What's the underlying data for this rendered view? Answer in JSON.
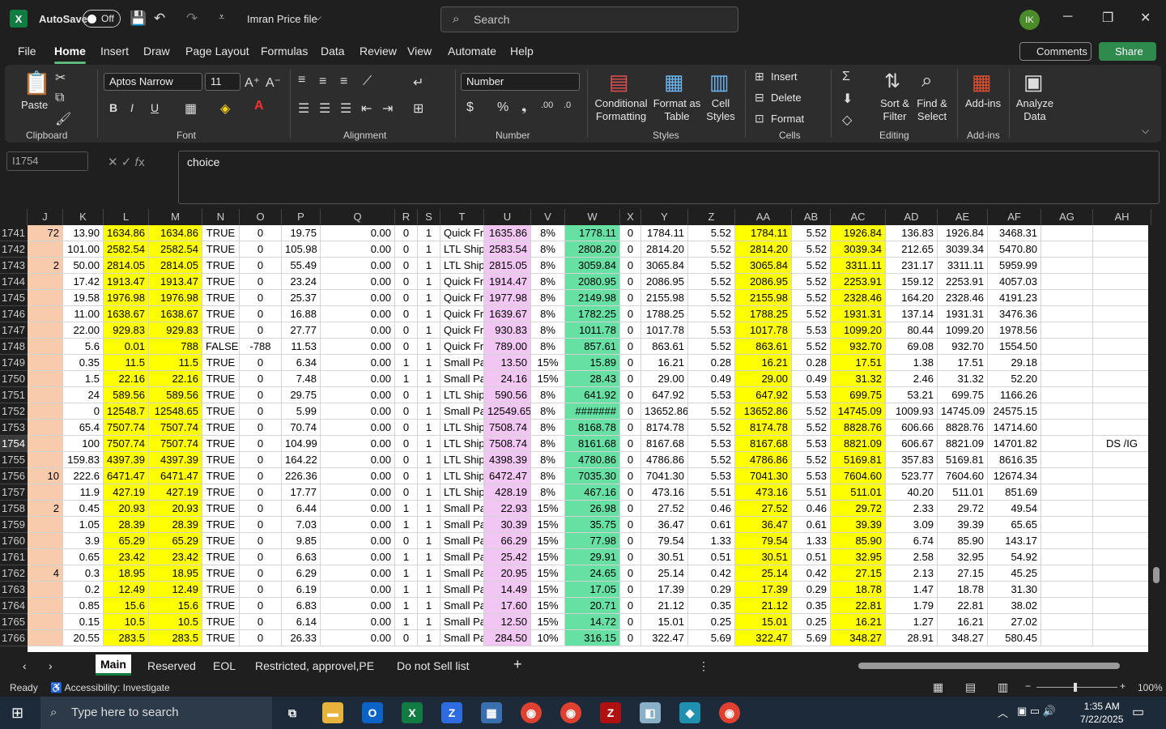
{
  "titlebar": {
    "autosave_label": "AutoSave",
    "autosave_state": "Off",
    "filename": "Imran Price file",
    "search_placeholder": "Search",
    "user_initials": "IK"
  },
  "menu": {
    "items": [
      "File",
      "Home",
      "Insert",
      "Draw",
      "Page Layout",
      "Formulas",
      "Data",
      "Review",
      "View",
      "Automate",
      "Help"
    ],
    "comments": "Comments",
    "share": "Share"
  },
  "ribbon": {
    "paste": "Paste",
    "clipboard": "Clipboard",
    "font_name": "Aptos Narrow",
    "font_size": "11",
    "font": "Font",
    "alignment": "Alignment",
    "number_format": "Number",
    "number": "Number",
    "conditional_formatting": "Conditional Formatting",
    "format_as_table": "Format as Table",
    "cell_styles": "Cell Styles",
    "styles": "Styles",
    "insert": "Insert",
    "delete": "Delete",
    "format": "Format",
    "cells": "Cells",
    "sort_filter": "Sort & Filter",
    "find_select": "Find & Select",
    "editing": "Editing",
    "addins_btn": "Add-ins",
    "addins": "Add-ins",
    "analyze_data": "Analyze Data"
  },
  "formula": {
    "namebox": "I1754",
    "value": "choice"
  },
  "columns": [
    "J",
    "K",
    "L",
    "M",
    "N",
    "O",
    "P",
    "Q",
    "R",
    "S",
    "T",
    "U",
    "V",
    "W",
    "X",
    "Y",
    "Z",
    "AA",
    "AB",
    "AC",
    "AD",
    "AE",
    "AF",
    "AG",
    "AH"
  ],
  "rows": [
    {
      "n": "1741",
      "c": [
        "72",
        "13.90",
        "1634.86",
        "1634.86",
        "TRUE",
        "0",
        "19.75",
        "0.00",
        "0",
        "1",
        "Quick Fr",
        "1635.86",
        "8%",
        "1778.11",
        "0",
        "1784.11",
        "5.52",
        "1784.11",
        "5.52",
        "1926.84",
        "136.83",
        "1926.84",
        "3468.31",
        "",
        ""
      ]
    },
    {
      "n": "1742",
      "c": [
        "",
        "101.00",
        "2582.54",
        "2582.54",
        "TRUE",
        "0",
        "105.98",
        "0.00",
        "0",
        "1",
        "LTL Ship",
        "2583.54",
        "8%",
        "2808.20",
        "0",
        "2814.20",
        "5.52",
        "2814.20",
        "5.52",
        "3039.34",
        "212.65",
        "3039.34",
        "5470.80",
        "",
        ""
      ]
    },
    {
      "n": "1743",
      "c": [
        "2",
        "50.00",
        "2814.05",
        "2814.05",
        "TRUE",
        "0",
        "55.49",
        "0.00",
        "0",
        "1",
        "LTL Ship",
        "2815.05",
        "8%",
        "3059.84",
        "0",
        "3065.84",
        "5.52",
        "3065.84",
        "5.52",
        "3311.11",
        "231.17",
        "3311.11",
        "5959.99",
        "",
        ""
      ]
    },
    {
      "n": "1744",
      "c": [
        "",
        "17.42",
        "1913.47",
        "1913.47",
        "TRUE",
        "0",
        "23.24",
        "0.00",
        "0",
        "1",
        "Quick Fr",
        "1914.47",
        "8%",
        "2080.95",
        "0",
        "2086.95",
        "5.52",
        "2086.95",
        "5.52",
        "2253.91",
        "159.12",
        "2253.91",
        "4057.03",
        "",
        ""
      ]
    },
    {
      "n": "1745",
      "c": [
        "",
        "19.58",
        "1976.98",
        "1976.98",
        "TRUE",
        "0",
        "25.37",
        "0.00",
        "0",
        "1",
        "Quick Fr",
        "1977.98",
        "8%",
        "2149.98",
        "0",
        "2155.98",
        "5.52",
        "2155.98",
        "5.52",
        "2328.46",
        "164.20",
        "2328.46",
        "4191.23",
        "",
        ""
      ]
    },
    {
      "n": "1746",
      "c": [
        "",
        "11.00",
        "1638.67",
        "1638.67",
        "TRUE",
        "0",
        "16.88",
        "0.00",
        "0",
        "1",
        "Quick Fr",
        "1639.67",
        "8%",
        "1782.25",
        "0",
        "1788.25",
        "5.52",
        "1788.25",
        "5.52",
        "1931.31",
        "137.14",
        "1931.31",
        "3476.36",
        "",
        ""
      ]
    },
    {
      "n": "1747",
      "c": [
        "",
        "22.00",
        "929.83",
        "929.83",
        "TRUE",
        "0",
        "27.77",
        "0.00",
        "0",
        "1",
        "Quick Fr",
        "930.83",
        "8%",
        "1011.78",
        "0",
        "1017.78",
        "5.53",
        "1017.78",
        "5.53",
        "1099.20",
        "80.44",
        "1099.20",
        "1978.56",
        "",
        ""
      ]
    },
    {
      "n": "1748",
      "c": [
        "",
        "5.6",
        "0.01",
        "788",
        "FALSE",
        "-788",
        "11.53",
        "0.00",
        "0",
        "1",
        "Quick Fr",
        "789.00",
        "8%",
        "857.61",
        "0",
        "863.61",
        "5.52",
        "863.61",
        "5.52",
        "932.70",
        "69.08",
        "932.70",
        "1554.50",
        "",
        ""
      ]
    },
    {
      "n": "1749",
      "c": [
        "",
        "0.35",
        "11.5",
        "11.5",
        "TRUE",
        "0",
        "6.34",
        "0.00",
        "1",
        "1",
        "Small Pa",
        "13.50",
        "15%",
        "15.89",
        "0",
        "16.21",
        "0.28",
        "16.21",
        "0.28",
        "17.51",
        "1.38",
        "17.51",
        "29.18",
        "",
        ""
      ]
    },
    {
      "n": "1750",
      "c": [
        "",
        "1.5",
        "22.16",
        "22.16",
        "TRUE",
        "0",
        "7.48",
        "0.00",
        "1",
        "1",
        "Small Pa",
        "24.16",
        "15%",
        "28.43",
        "0",
        "29.00",
        "0.49",
        "29.00",
        "0.49",
        "31.32",
        "2.46",
        "31.32",
        "52.20",
        "",
        ""
      ]
    },
    {
      "n": "1751",
      "c": [
        "",
        "24",
        "589.56",
        "589.56",
        "TRUE",
        "0",
        "29.75",
        "0.00",
        "0",
        "1",
        "LTL Ship",
        "590.56",
        "8%",
        "641.92",
        "0",
        "647.92",
        "5.53",
        "647.92",
        "5.53",
        "699.75",
        "53.21",
        "699.75",
        "1166.26",
        "",
        ""
      ]
    },
    {
      "n": "1752",
      "c": [
        "",
        "0",
        "12548.7",
        "12548.65",
        "TRUE",
        "0",
        "5.99",
        "0.00",
        "0",
        "1",
        "Small Pa",
        "12549.65",
        "8%",
        "#######",
        "0",
        "13652.86",
        "5.52",
        "13652.86",
        "5.52",
        "14745.09",
        "1009.93",
        "14745.09",
        "24575.15",
        "",
        ""
      ]
    },
    {
      "n": "1753",
      "c": [
        "",
        "65.4",
        "7507.74",
        "7507.74",
        "TRUE",
        "0",
        "70.74",
        "0.00",
        "0",
        "1",
        "LTL Ship",
        "7508.74",
        "8%",
        "8168.78",
        "0",
        "8174.78",
        "5.52",
        "8174.78",
        "5.52",
        "8828.76",
        "606.66",
        "8828.76",
        "14714.60",
        "",
        ""
      ]
    },
    {
      "n": "1754",
      "c": [
        "",
        "100",
        "7507.74",
        "7507.74",
        "TRUE",
        "0",
        "104.99",
        "0.00",
        "0",
        "1",
        "LTL Ship",
        "7508.74",
        "8%",
        "8161.68",
        "0",
        "8167.68",
        "5.53",
        "8167.68",
        "5.53",
        "8821.09",
        "606.67",
        "8821.09",
        "14701.82",
        "",
        "DS /IG"
      ]
    },
    {
      "n": "1755",
      "c": [
        "",
        "159.83",
        "4397.39",
        "4397.39",
        "TRUE",
        "0",
        "164.22",
        "0.00",
        "0",
        "1",
        "LTL Ship",
        "4398.39",
        "8%",
        "4780.86",
        "0",
        "4786.86",
        "5.52",
        "4786.86",
        "5.52",
        "5169.81",
        "357.83",
        "5169.81",
        "8616.35",
        "",
        ""
      ]
    },
    {
      "n": "1756",
      "c": [
        "10",
        "222.6",
        "6471.47",
        "6471.47",
        "TRUE",
        "0",
        "226.36",
        "0.00",
        "0",
        "1",
        "LTL Ship",
        "6472.47",
        "8%",
        "7035.30",
        "0",
        "7041.30",
        "5.53",
        "7041.30",
        "5.53",
        "7604.60",
        "523.77",
        "7604.60",
        "12674.34",
        "",
        ""
      ]
    },
    {
      "n": "1757",
      "c": [
        "",
        "11.9",
        "427.19",
        "427.19",
        "TRUE",
        "0",
        "17.77",
        "0.00",
        "0",
        "1",
        "LTL Ship",
        "428.19",
        "8%",
        "467.16",
        "0",
        "473.16",
        "5.51",
        "473.16",
        "5.51",
        "511.01",
        "40.20",
        "511.01",
        "851.69",
        "",
        ""
      ]
    },
    {
      "n": "1758",
      "c": [
        "2",
        "0.45",
        "20.93",
        "20.93",
        "TRUE",
        "0",
        "6.44",
        "0.00",
        "1",
        "1",
        "Small Pa",
        "22.93",
        "15%",
        "26.98",
        "0",
        "27.52",
        "0.46",
        "27.52",
        "0.46",
        "29.72",
        "2.33",
        "29.72",
        "49.54",
        "",
        ""
      ]
    },
    {
      "n": "1759",
      "c": [
        "",
        "1.05",
        "28.39",
        "28.39",
        "TRUE",
        "0",
        "7.03",
        "0.00",
        "1",
        "1",
        "Small Pa",
        "30.39",
        "15%",
        "35.75",
        "0",
        "36.47",
        "0.61",
        "36.47",
        "0.61",
        "39.39",
        "3.09",
        "39.39",
        "65.65",
        "",
        ""
      ]
    },
    {
      "n": "1760",
      "c": [
        "",
        "3.9",
        "65.29",
        "65.29",
        "TRUE",
        "0",
        "9.85",
        "0.00",
        "0",
        "1",
        "Small Pa",
        "66.29",
        "15%",
        "77.98",
        "0",
        "79.54",
        "1.33",
        "79.54",
        "1.33",
        "85.90",
        "6.74",
        "85.90",
        "143.17",
        "",
        ""
      ]
    },
    {
      "n": "1761",
      "c": [
        "",
        "0.65",
        "23.42",
        "23.42",
        "TRUE",
        "0",
        "6.63",
        "0.00",
        "1",
        "1",
        "Small Pa",
        "25.42",
        "15%",
        "29.91",
        "0",
        "30.51",
        "0.51",
        "30.51",
        "0.51",
        "32.95",
        "2.58",
        "32.95",
        "54.92",
        "",
        ""
      ]
    },
    {
      "n": "1762",
      "c": [
        "4",
        "0.3",
        "18.95",
        "18.95",
        "TRUE",
        "0",
        "6.29",
        "0.00",
        "1",
        "1",
        "Small Pa",
        "20.95",
        "15%",
        "24.65",
        "0",
        "25.14",
        "0.42",
        "25.14",
        "0.42",
        "27.15",
        "2.13",
        "27.15",
        "45.25",
        "",
        ""
      ]
    },
    {
      "n": "1763",
      "c": [
        "",
        "0.2",
        "12.49",
        "12.49",
        "TRUE",
        "0",
        "6.19",
        "0.00",
        "1",
        "1",
        "Small Pa",
        "14.49",
        "15%",
        "17.05",
        "0",
        "17.39",
        "0.29",
        "17.39",
        "0.29",
        "18.78",
        "1.47",
        "18.78",
        "31.30",
        "",
        ""
      ]
    },
    {
      "n": "1764",
      "c": [
        "",
        "0.85",
        "15.6",
        "15.6",
        "TRUE",
        "0",
        "6.83",
        "0.00",
        "1",
        "1",
        "Small Pa",
        "17.60",
        "15%",
        "20.71",
        "0",
        "21.12",
        "0.35",
        "21.12",
        "0.35",
        "22.81",
        "1.79",
        "22.81",
        "38.02",
        "",
        ""
      ]
    },
    {
      "n": "1765",
      "c": [
        "",
        "0.15",
        "10.5",
        "10.5",
        "TRUE",
        "0",
        "6.14",
        "0.00",
        "1",
        "1",
        "Small Pa",
        "12.50",
        "15%",
        "14.72",
        "0",
        "15.01",
        "0.25",
        "15.01",
        "0.25",
        "16.21",
        "1.27",
        "16.21",
        "27.02",
        "",
        ""
      ]
    },
    {
      "n": "1766",
      "c": [
        "",
        "20.55",
        "283.5",
        "283.5",
        "TRUE",
        "0",
        "26.33",
        "0.00",
        "0",
        "1",
        "Small Pa",
        "284.50",
        "10%",
        "316.15",
        "0",
        "322.47",
        "5.69",
        "322.47",
        "5.69",
        "348.27",
        "28.91",
        "348.27",
        "580.45",
        "",
        ""
      ]
    }
  ],
  "colors": {
    "yellow": "#ffff00",
    "pink": "#f2c6f2",
    "green": "#66e0a3",
    "peach": "#f8cbad",
    "selected_row": "#3a3a3a"
  },
  "sheets": [
    "Main",
    "Reserved",
    "EOL",
    "Restricted, approvel,PE",
    "Do not Sell list"
  ],
  "status": {
    "ready": "Ready",
    "accessibility": "Accessibility: Investigate",
    "zoom": "100%"
  },
  "taskbar": {
    "search_placeholder": "Type here to search",
    "time": "1:35 AM",
    "date": "7/22/2025"
  }
}
